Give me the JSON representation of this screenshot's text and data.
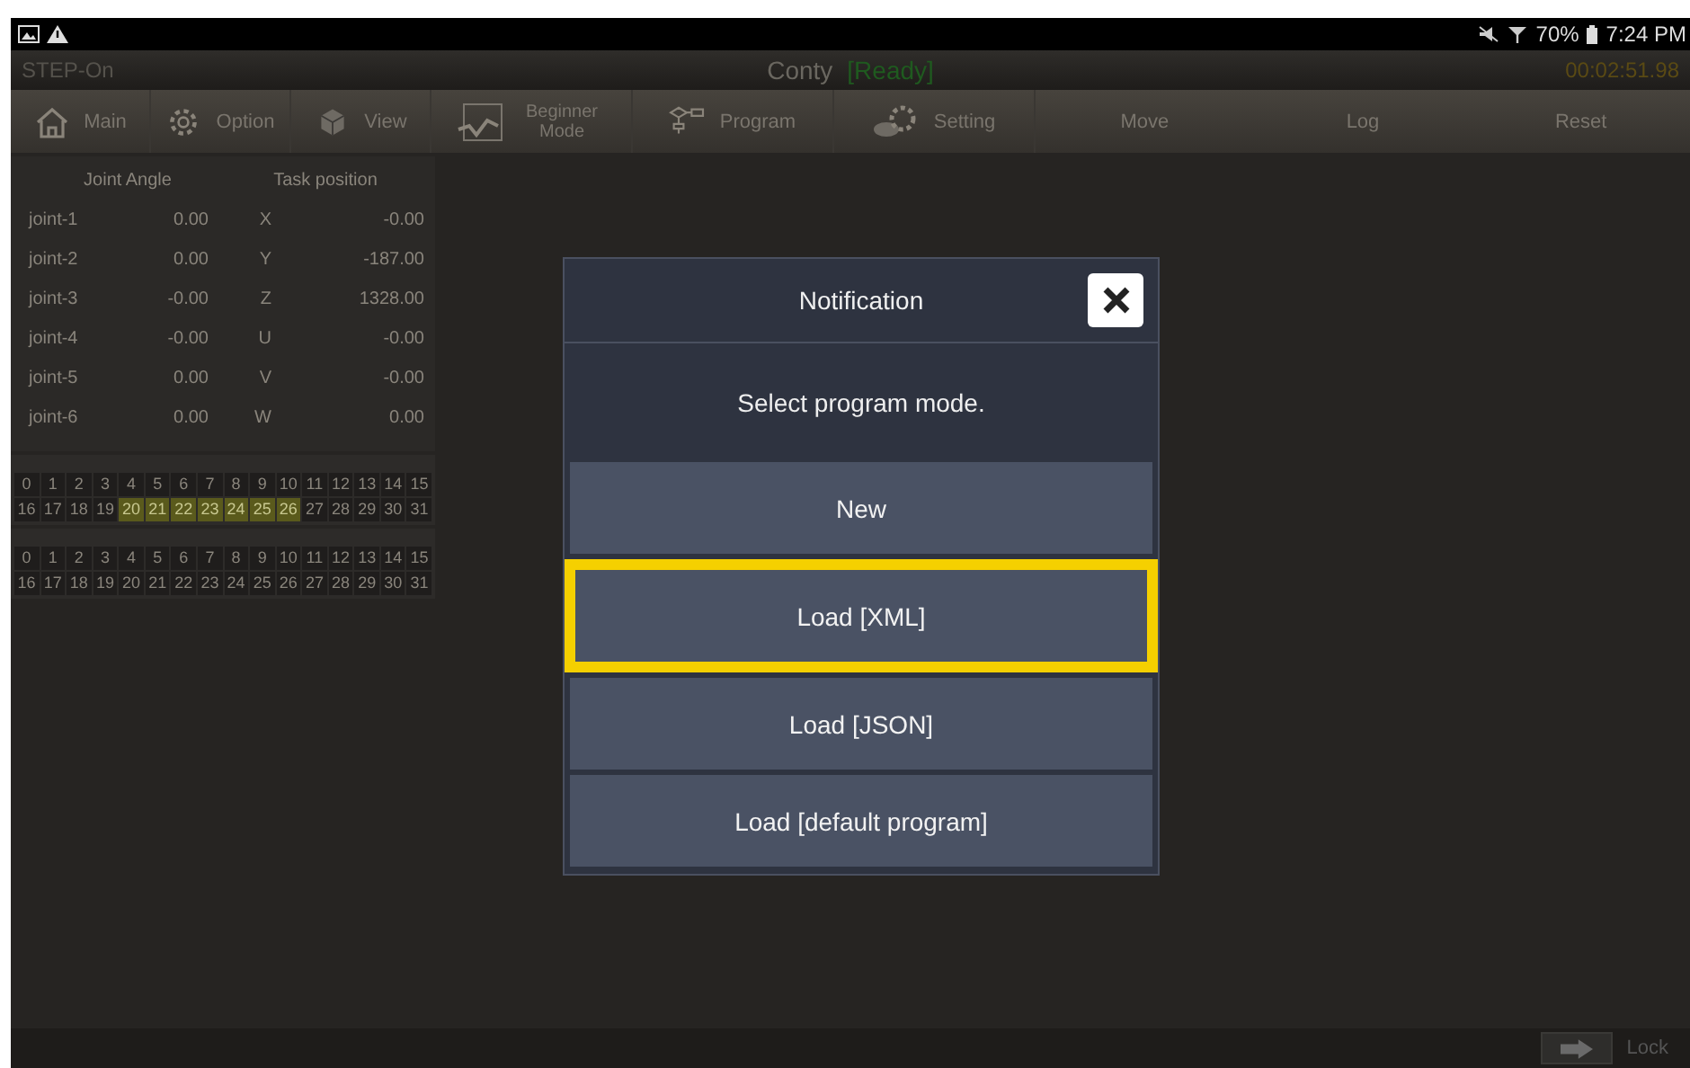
{
  "status_bar": {
    "battery": "70%",
    "time": "7:24 PM"
  },
  "title_bar": {
    "left": "STEP-On",
    "robot": "Conty",
    "state": "[Ready]",
    "timer": "00:02:51.98"
  },
  "toolbar": [
    {
      "label": "Main",
      "kind": "home"
    },
    {
      "label": "Option",
      "kind": "gear"
    },
    {
      "label": "View",
      "kind": "cube"
    },
    {
      "label": "Beginner Mode",
      "kind": "chart"
    },
    {
      "label": "Program",
      "kind": "flow"
    },
    {
      "label": "Setting",
      "kind": "gears"
    },
    {
      "label": "Move",
      "kind": "text"
    },
    {
      "label": "Log",
      "kind": "text"
    },
    {
      "label": "Reset",
      "kind": "text"
    }
  ],
  "positions": {
    "joint_header": "Joint Angle",
    "task_header": "Task position",
    "rows": [
      {
        "joint": "joint-1",
        "angle": "0.00",
        "axis": "X",
        "value": "-0.00"
      },
      {
        "joint": "joint-2",
        "angle": "0.00",
        "axis": "Y",
        "value": "-187.00"
      },
      {
        "joint": "joint-3",
        "angle": "-0.00",
        "axis": "Z",
        "value": "1328.00"
      },
      {
        "joint": "joint-4",
        "angle": "-0.00",
        "axis": "U",
        "value": "-0.00"
      },
      {
        "joint": "joint-5",
        "angle": "0.00",
        "axis": "V",
        "value": "-0.00"
      },
      {
        "joint": "joint-6",
        "angle": "0.00",
        "axis": "W",
        "value": "0.00"
      }
    ]
  },
  "io_grids": [
    {
      "cells": [
        {
          "label": "0",
          "on": false
        },
        {
          "label": "1",
          "on": false
        },
        {
          "label": "2",
          "on": false
        },
        {
          "label": "3",
          "on": false
        },
        {
          "label": "4",
          "on": false
        },
        {
          "label": "5",
          "on": false
        },
        {
          "label": "6",
          "on": false
        },
        {
          "label": "7",
          "on": false
        },
        {
          "label": "8",
          "on": false
        },
        {
          "label": "9",
          "on": false
        },
        {
          "label": "10",
          "on": false
        },
        {
          "label": "11",
          "on": false
        },
        {
          "label": "12",
          "on": false
        },
        {
          "label": "13",
          "on": false
        },
        {
          "label": "14",
          "on": false
        },
        {
          "label": "15",
          "on": false
        },
        {
          "label": "16",
          "on": false
        },
        {
          "label": "17",
          "on": false
        },
        {
          "label": "18",
          "on": false
        },
        {
          "label": "19",
          "on": false
        },
        {
          "label": "20",
          "on": true
        },
        {
          "label": "21",
          "on": true
        },
        {
          "label": "22",
          "on": true
        },
        {
          "label": "23",
          "on": true
        },
        {
          "label": "24",
          "on": true
        },
        {
          "label": "25",
          "on": true
        },
        {
          "label": "26",
          "on": true
        },
        {
          "label": "27",
          "on": false
        },
        {
          "label": "28",
          "on": false
        },
        {
          "label": "29",
          "on": false
        },
        {
          "label": "30",
          "on": false
        },
        {
          "label": "31",
          "on": false
        }
      ]
    },
    {
      "cells": [
        {
          "label": "0",
          "on": false
        },
        {
          "label": "1",
          "on": false
        },
        {
          "label": "2",
          "on": false
        },
        {
          "label": "3",
          "on": false
        },
        {
          "label": "4",
          "on": false
        },
        {
          "label": "5",
          "on": false
        },
        {
          "label": "6",
          "on": false
        },
        {
          "label": "7",
          "on": false
        },
        {
          "label": "8",
          "on": false
        },
        {
          "label": "9",
          "on": false
        },
        {
          "label": "10",
          "on": false
        },
        {
          "label": "11",
          "on": false
        },
        {
          "label": "12",
          "on": false
        },
        {
          "label": "13",
          "on": false
        },
        {
          "label": "14",
          "on": false
        },
        {
          "label": "15",
          "on": false
        },
        {
          "label": "16",
          "on": false
        },
        {
          "label": "17",
          "on": false
        },
        {
          "label": "18",
          "on": false
        },
        {
          "label": "19",
          "on": false
        },
        {
          "label": "20",
          "on": false
        },
        {
          "label": "21",
          "on": false
        },
        {
          "label": "22",
          "on": false
        },
        {
          "label": "23",
          "on": false
        },
        {
          "label": "24",
          "on": false
        },
        {
          "label": "25",
          "on": false
        },
        {
          "label": "26",
          "on": false
        },
        {
          "label": "27",
          "on": false
        },
        {
          "label": "28",
          "on": false
        },
        {
          "label": "29",
          "on": false
        },
        {
          "label": "30",
          "on": false
        },
        {
          "label": "31",
          "on": false
        }
      ]
    }
  ],
  "dialog": {
    "title": "Notification",
    "message": "Select program mode.",
    "options": [
      {
        "label": "New",
        "selected": false
      },
      {
        "label": "Load [XML]",
        "selected": true
      },
      {
        "label": "Load [JSON]",
        "selected": false
      },
      {
        "label": "Load [default program]",
        "selected": false
      }
    ]
  },
  "footer": {
    "lock": "Lock"
  }
}
